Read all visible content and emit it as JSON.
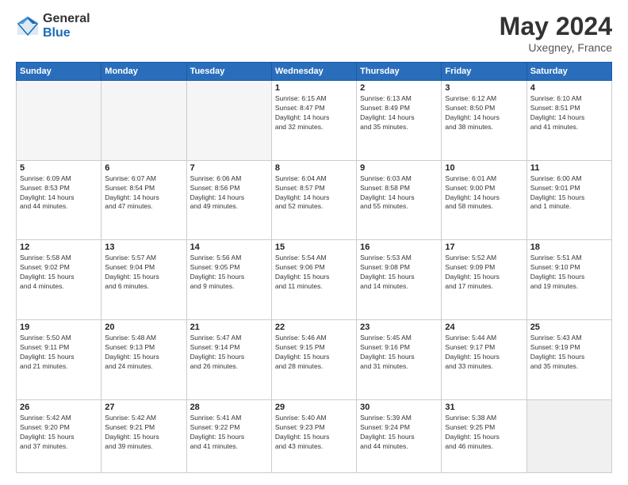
{
  "header": {
    "logo_general": "General",
    "logo_blue": "Blue",
    "title": "May 2024",
    "location": "Uxegney, France"
  },
  "days_of_week": [
    "Sunday",
    "Monday",
    "Tuesday",
    "Wednesday",
    "Thursday",
    "Friday",
    "Saturday"
  ],
  "weeks": [
    [
      {
        "day": "",
        "info": "",
        "empty": true
      },
      {
        "day": "",
        "info": "",
        "empty": true
      },
      {
        "day": "",
        "info": "",
        "empty": true
      },
      {
        "day": "1",
        "info": "Sunrise: 6:15 AM\nSunset: 8:47 PM\nDaylight: 14 hours\nand 32 minutes."
      },
      {
        "day": "2",
        "info": "Sunrise: 6:13 AM\nSunset: 8:49 PM\nDaylight: 14 hours\nand 35 minutes."
      },
      {
        "day": "3",
        "info": "Sunrise: 6:12 AM\nSunset: 8:50 PM\nDaylight: 14 hours\nand 38 minutes."
      },
      {
        "day": "4",
        "info": "Sunrise: 6:10 AM\nSunset: 8:51 PM\nDaylight: 14 hours\nand 41 minutes."
      }
    ],
    [
      {
        "day": "5",
        "info": "Sunrise: 6:09 AM\nSunset: 8:53 PM\nDaylight: 14 hours\nand 44 minutes."
      },
      {
        "day": "6",
        "info": "Sunrise: 6:07 AM\nSunset: 8:54 PM\nDaylight: 14 hours\nand 47 minutes."
      },
      {
        "day": "7",
        "info": "Sunrise: 6:06 AM\nSunset: 8:56 PM\nDaylight: 14 hours\nand 49 minutes."
      },
      {
        "day": "8",
        "info": "Sunrise: 6:04 AM\nSunset: 8:57 PM\nDaylight: 14 hours\nand 52 minutes."
      },
      {
        "day": "9",
        "info": "Sunrise: 6:03 AM\nSunset: 8:58 PM\nDaylight: 14 hours\nand 55 minutes."
      },
      {
        "day": "10",
        "info": "Sunrise: 6:01 AM\nSunset: 9:00 PM\nDaylight: 14 hours\nand 58 minutes."
      },
      {
        "day": "11",
        "info": "Sunrise: 6:00 AM\nSunset: 9:01 PM\nDaylight: 15 hours\nand 1 minute."
      }
    ],
    [
      {
        "day": "12",
        "info": "Sunrise: 5:58 AM\nSunset: 9:02 PM\nDaylight: 15 hours\nand 4 minutes."
      },
      {
        "day": "13",
        "info": "Sunrise: 5:57 AM\nSunset: 9:04 PM\nDaylight: 15 hours\nand 6 minutes."
      },
      {
        "day": "14",
        "info": "Sunrise: 5:56 AM\nSunset: 9:05 PM\nDaylight: 15 hours\nand 9 minutes."
      },
      {
        "day": "15",
        "info": "Sunrise: 5:54 AM\nSunset: 9:06 PM\nDaylight: 15 hours\nand 11 minutes."
      },
      {
        "day": "16",
        "info": "Sunrise: 5:53 AM\nSunset: 9:08 PM\nDaylight: 15 hours\nand 14 minutes."
      },
      {
        "day": "17",
        "info": "Sunrise: 5:52 AM\nSunset: 9:09 PM\nDaylight: 15 hours\nand 17 minutes."
      },
      {
        "day": "18",
        "info": "Sunrise: 5:51 AM\nSunset: 9:10 PM\nDaylight: 15 hours\nand 19 minutes."
      }
    ],
    [
      {
        "day": "19",
        "info": "Sunrise: 5:50 AM\nSunset: 9:11 PM\nDaylight: 15 hours\nand 21 minutes."
      },
      {
        "day": "20",
        "info": "Sunrise: 5:48 AM\nSunset: 9:13 PM\nDaylight: 15 hours\nand 24 minutes."
      },
      {
        "day": "21",
        "info": "Sunrise: 5:47 AM\nSunset: 9:14 PM\nDaylight: 15 hours\nand 26 minutes."
      },
      {
        "day": "22",
        "info": "Sunrise: 5:46 AM\nSunset: 9:15 PM\nDaylight: 15 hours\nand 28 minutes."
      },
      {
        "day": "23",
        "info": "Sunrise: 5:45 AM\nSunset: 9:16 PM\nDaylight: 15 hours\nand 31 minutes."
      },
      {
        "day": "24",
        "info": "Sunrise: 5:44 AM\nSunset: 9:17 PM\nDaylight: 15 hours\nand 33 minutes."
      },
      {
        "day": "25",
        "info": "Sunrise: 5:43 AM\nSunset: 9:19 PM\nDaylight: 15 hours\nand 35 minutes."
      }
    ],
    [
      {
        "day": "26",
        "info": "Sunrise: 5:42 AM\nSunset: 9:20 PM\nDaylight: 15 hours\nand 37 minutes."
      },
      {
        "day": "27",
        "info": "Sunrise: 5:42 AM\nSunset: 9:21 PM\nDaylight: 15 hours\nand 39 minutes."
      },
      {
        "day": "28",
        "info": "Sunrise: 5:41 AM\nSunset: 9:22 PM\nDaylight: 15 hours\nand 41 minutes."
      },
      {
        "day": "29",
        "info": "Sunrise: 5:40 AM\nSunset: 9:23 PM\nDaylight: 15 hours\nand 43 minutes."
      },
      {
        "day": "30",
        "info": "Sunrise: 5:39 AM\nSunset: 9:24 PM\nDaylight: 15 hours\nand 44 minutes."
      },
      {
        "day": "31",
        "info": "Sunrise: 5:38 AM\nSunset: 9:25 PM\nDaylight: 15 hours\nand 46 minutes."
      },
      {
        "day": "",
        "info": "",
        "empty": true,
        "shaded": true
      }
    ]
  ]
}
